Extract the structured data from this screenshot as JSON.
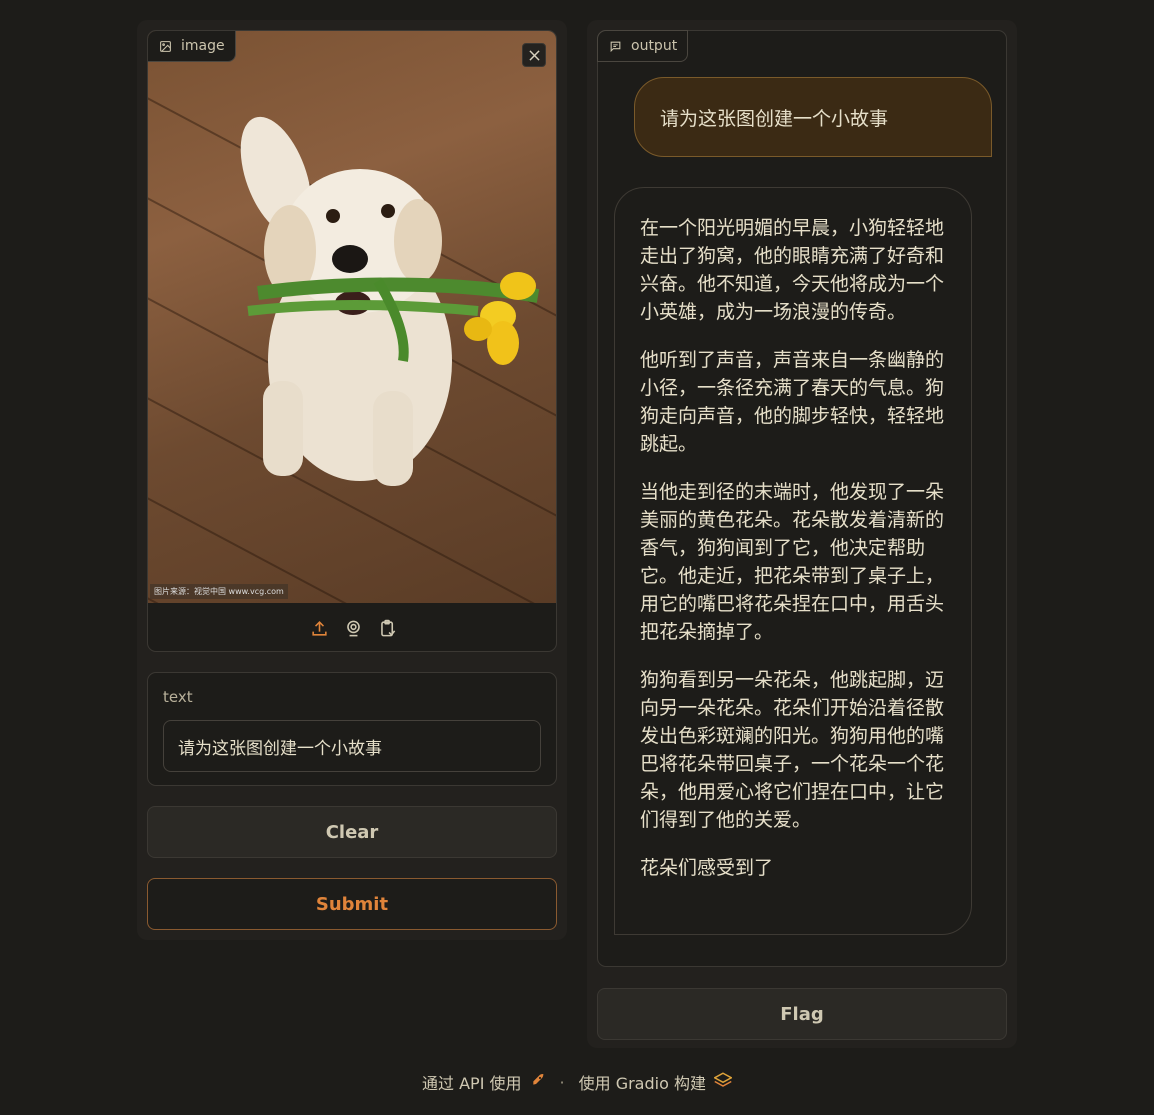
{
  "input": {
    "image_label": "image",
    "image_label_icon": "image-icon",
    "close_icon": "close-icon",
    "watermark": "图片来源：视觉中国 www.vcg.com",
    "tools": [
      "upload-icon",
      "webcam-icon",
      "clipboard-icon"
    ],
    "text_label": "text",
    "text_value": "请为这张图创建一个小故事"
  },
  "buttons": {
    "clear": "Clear",
    "submit": "Submit",
    "flag": "Flag"
  },
  "output": {
    "label": "output",
    "label_icon": "chat-icon",
    "user_message": "请为这张图创建一个小故事",
    "bot_paragraphs": [
      "在一个阳光明媚的早晨，小狗轻轻地走出了狗窝，他的眼睛充满了好奇和兴奋。他不知道，今天他将成为一个小英雄，成为一场浪漫的传奇。",
      "他听到了声音，声音来自一条幽静的小径，一条径充满了春天的气息。狗狗走向声音，他的脚步轻快，轻轻地跳起。",
      "当他走到径的末端时，他发现了一朵美丽的黄色花朵。花朵散发着清新的香气，狗狗闻到了它，他决定帮助它。他走近，把花朵带到了桌子上，用它的嘴巴将花朵捏在口中，用舌头把花朵摘掉了。",
      "狗狗看到另一朵花朵，他跳起脚，迈向另一朵花朵。花朵们开始沿着径散发出色彩斑斓的阳光。狗狗用他的嘴巴将花朵带回桌子，一个花朵一个花朵，他用爱心将它们捏在口中，让它们得到了他的关爱。",
      "花朵们感受到了"
    ]
  },
  "footer": {
    "api_text": "通过 API 使用",
    "separator": "·",
    "built_text": "使用 Gradio 构建"
  },
  "colors": {
    "background": "#1d1c19",
    "panel": "#23211e",
    "accent": "#e0843a",
    "user_bubble": "#3b2a14"
  }
}
